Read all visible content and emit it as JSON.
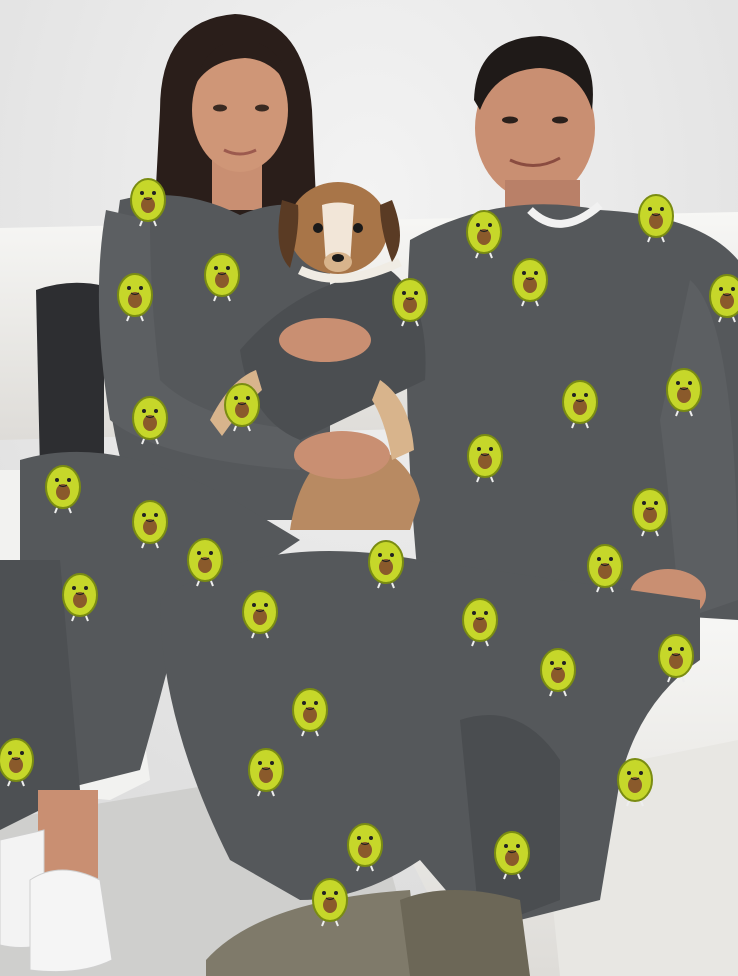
{
  "scene": {
    "description_colors": {
      "wall": "#ececec",
      "sofa": "#f4f4f2",
      "sofa_shadow": "#d9d9d6",
      "floor": "#cfcfcd",
      "pajama": "#55585b",
      "pajama_dark": "#3f4245",
      "pajama_light": "#6c6f72",
      "avocado_skin": "#c6d72a",
      "avocado_dark": "#7a8c12",
      "avocado_pit": "#8a5a2b",
      "skin": "#c98f72",
      "skin_dark": "#a7705a",
      "hair": "#2a1e1a",
      "dog_brown": "#a87548",
      "dog_tan": "#d8b48c",
      "pillow": "#2d2e31",
      "sneaker": "#f5f5f5",
      "slipper": "#7f7a6a"
    },
    "icons": [
      "avocado-print-icon"
    ]
  }
}
